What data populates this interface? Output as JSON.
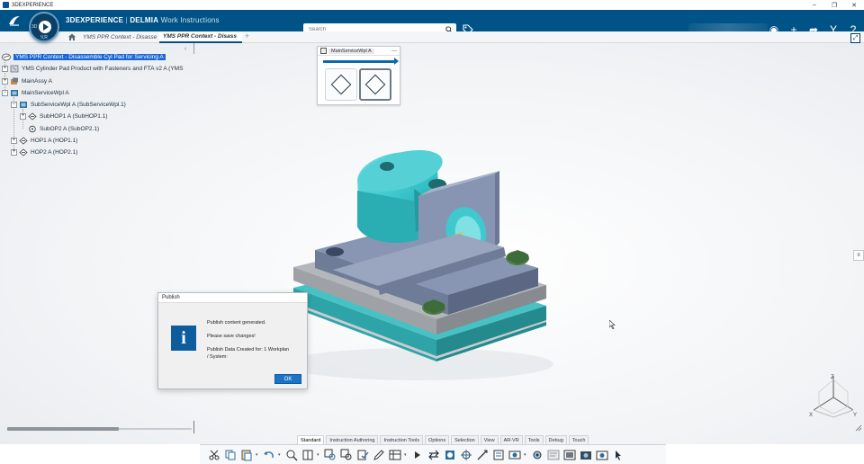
{
  "window": {
    "title": "3DEXPERIENCE"
  },
  "header": {
    "brand_main": "3DEXPERIENCE",
    "brand_sep": " | ",
    "brand_sub": "DELMIA",
    "brand_app": "Work Instructions",
    "compass_top_left": "3D",
    "compass_version": "V,R",
    "search_placeholder": "Search"
  },
  "tabs": [
    {
      "label": "YMS PPR Context - Disasse"
    },
    {
      "label": "YMS PPR Context - Disass"
    }
  ],
  "tree": {
    "nodes": [
      {
        "label": "YMS PPR Context - Disassemble Cyl Pad for Servicing A",
        "expander": ""
      },
      {
        "label": "YMS Cylinder Pad Product with Fasteners and FTA v2 A (YMS",
        "expander": "+"
      },
      {
        "label": "MainAssy A",
        "expander": "+"
      },
      {
        "label": "MainServiceWpl A",
        "expander": "−"
      },
      {
        "label": "SubServiceWpl A (SubServiceWpl.1)",
        "expander": "−"
      },
      {
        "label": "SubHOP1 A (SubHOP1.1)",
        "expander": "+"
      },
      {
        "label": "SubOP2 A (SubOP2.1)",
        "expander": ""
      },
      {
        "label": "HOP1 A (HOP1.1)",
        "expander": "+"
      },
      {
        "label": "HOP2 A (HOP2.1)",
        "expander": "+"
      }
    ]
  },
  "workplan_panel": {
    "title": "MainServiceWpl A"
  },
  "dialog": {
    "title": "Publish",
    "line1": "Publish content generated.",
    "line2": "Please save changes!",
    "line3": "Publish Data Created for:  1 Workplan",
    "line4": "/ System:",
    "ok_label": "OK"
  },
  "triad": {
    "z": "Z",
    "x": "X",
    "y": "Y"
  },
  "action_bar": {
    "tabs": [
      "Standard",
      "Instruction Authoring",
      "Instruction Tools",
      "Options",
      "Selection",
      "View",
      "AR-VR",
      "Tools",
      "Debug",
      "Touch"
    ],
    "active_tab": "Instruction Tools",
    "tools": [
      "cut-icon",
      "copy-icon",
      "paste-icon",
      "undo-icon",
      "zoom-icon",
      "book-icon",
      "measure-icon",
      "measure2-icon",
      "check-icon",
      "edit-icon",
      "table-icon",
      "play-icon",
      "swap-icon",
      "link-icon",
      "manipulate-icon",
      "compass-icon",
      "sheet-icon",
      "capture-icon",
      "mechanism-icon",
      "tree-icon",
      "screenshot-icon",
      "camera-icon",
      "camera2-icon",
      "pointer-icon"
    ]
  },
  "colors": {
    "topbar": "#005386",
    "selection": "#1a66d6",
    "part_cyan": "#3fc6cc",
    "part_steel": "#7d8ba8",
    "bolt_green": "#3e6b3a"
  }
}
